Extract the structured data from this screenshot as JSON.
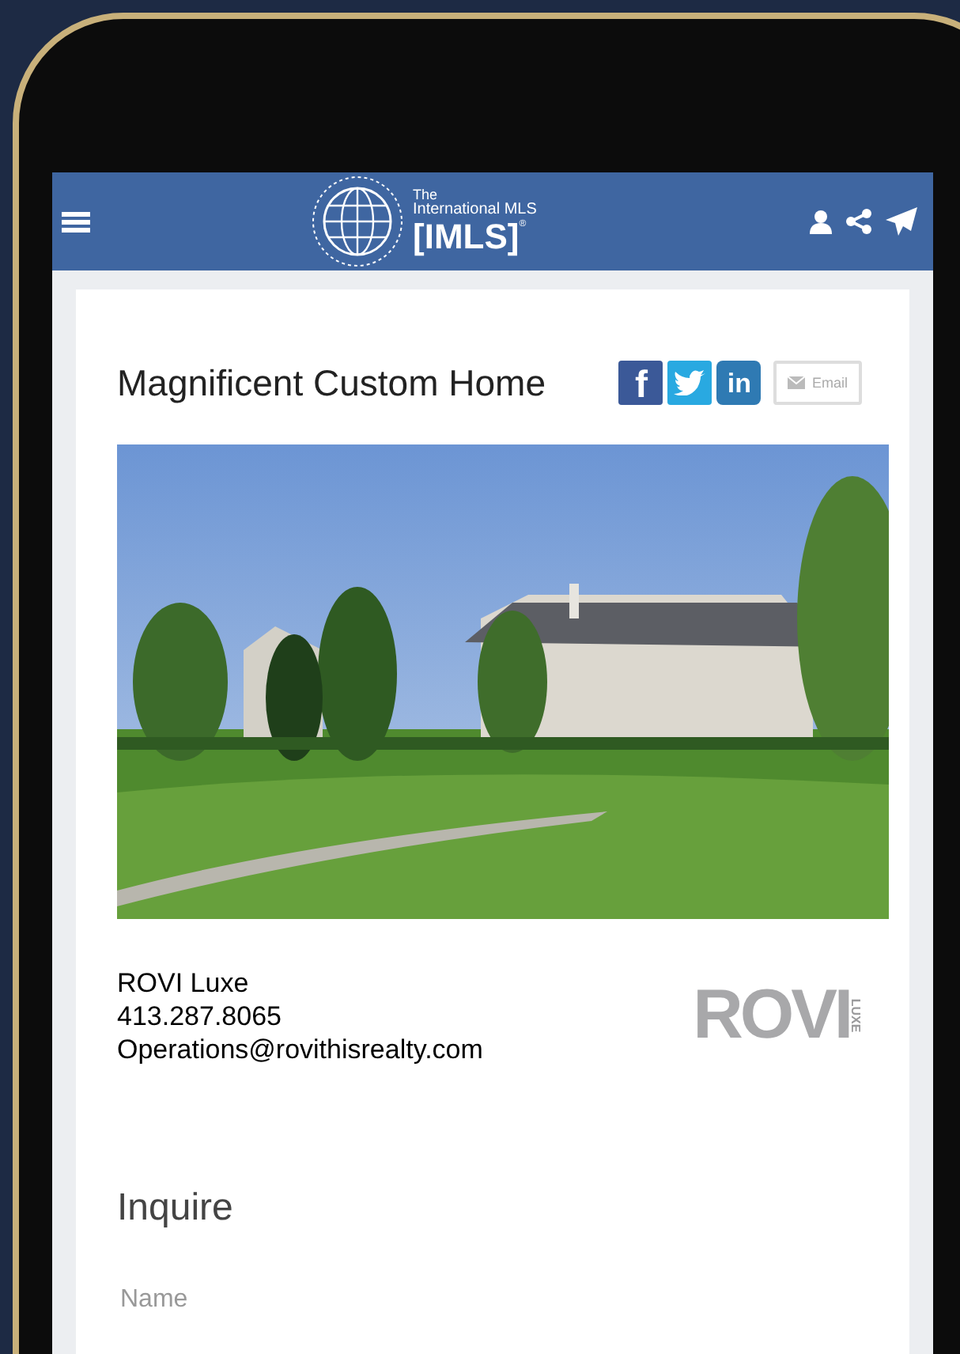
{
  "header": {
    "logo": {
      "small_text": "The",
      "name": "International MLS",
      "mark": "[IMLS]",
      "registered": "®"
    }
  },
  "listing": {
    "title": "Magnificent Custom Home",
    "share": [
      {
        "kind": "facebook",
        "label": "f"
      },
      {
        "kind": "twitter"
      },
      {
        "kind": "linkedin",
        "label": "in"
      },
      {
        "kind": "email",
        "label": "Email"
      }
    ]
  },
  "agent": {
    "name": "ROVI Luxe",
    "phone": "413.287.8065",
    "email": "Operations@rovithisrealty.com",
    "logo": {
      "name": "ROVI",
      "sub": "LUXE"
    }
  },
  "inquire": {
    "heading": "Inquire",
    "fields": [
      {
        "placeholder": "Name"
      }
    ]
  }
}
